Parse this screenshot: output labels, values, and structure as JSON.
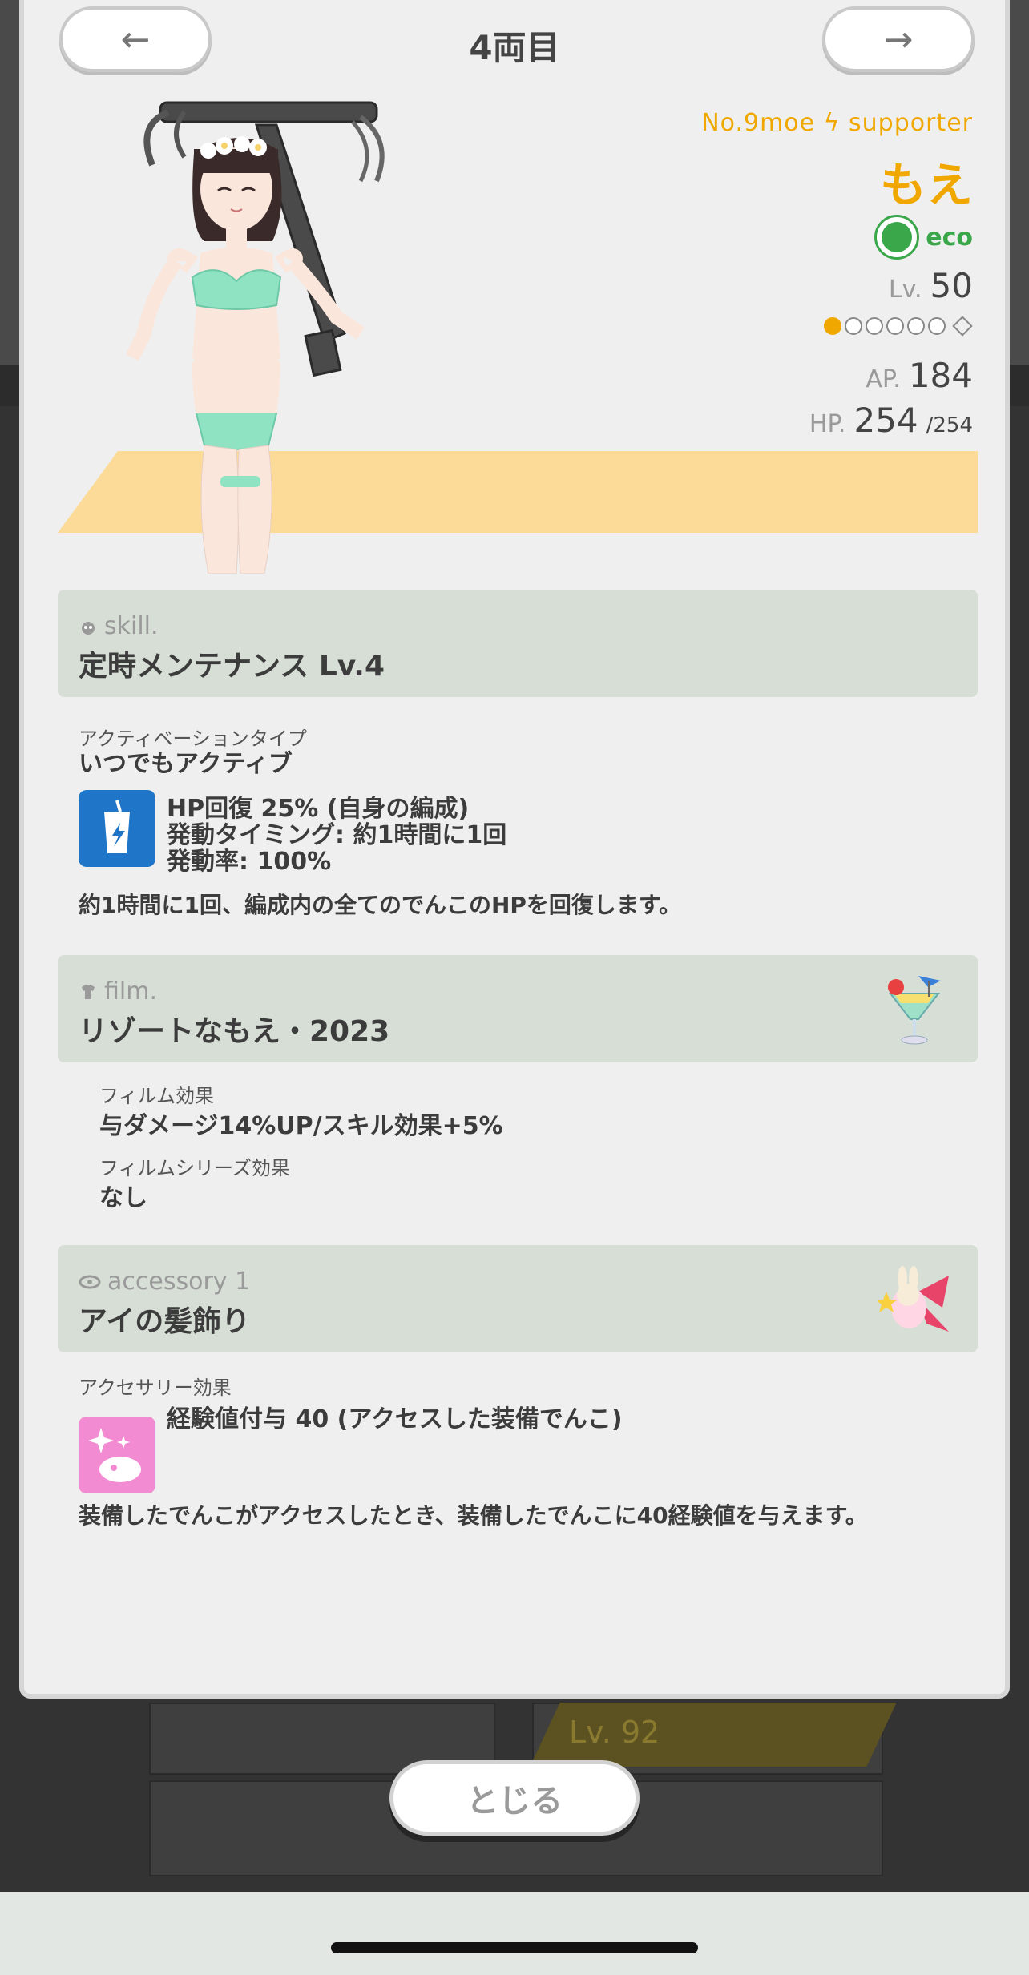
{
  "header": {
    "title": "4両目",
    "prev_label": "←",
    "next_label": "→"
  },
  "character": {
    "unit_no": "No.9moe",
    "role": "supporter",
    "bolt_glyph": "ϟ",
    "name": "もえ",
    "attribute": "eco",
    "level_label": "Lv.",
    "level": "50",
    "rank_filled": 1,
    "rank_total": 6,
    "ap_label": "AP.",
    "ap": "184",
    "hp_label": "HP.",
    "hp": "254",
    "hp_max": "/254"
  },
  "skill": {
    "section_label": "skill.",
    "name": "定時メンテナンス Lv.4",
    "activation_type_label": "アクティベーションタイプ",
    "activation_type": "いつでもアクティブ",
    "effect_line1": "HP回復 25% (自身の編成)",
    "effect_line2": "発動タイミング: 約1時間に1回",
    "effect_line3": "発動率: 100%",
    "description": "約1時間に1回、編成内の全てのでんこのHPを回復します。"
  },
  "film": {
    "section_label": "film.",
    "name": "リゾートなもえ・2023",
    "effect_label": "フィルム効果",
    "effect": "与ダメージ14%UP/スキル効果+5%",
    "series_label": "フィルムシリーズ効果",
    "series_effect": "なし"
  },
  "accessory": {
    "section_label": "accessory 1",
    "name": "アイの髪飾り",
    "effect_label": "アクセサリー効果",
    "effect": "経験値付与 40 (アクセスした装備でんこ)",
    "description": "装備したでんこがアクセスしたとき、装備したでんこに40経験値を与えます。"
  },
  "background": {
    "level_text": "Lv. 92"
  },
  "footer": {
    "close_label": "とじる"
  },
  "colors": {
    "accent_orange": "#f0a800",
    "eco_green": "#3aa84a",
    "section_bg": "#d6ded6",
    "skill_icon_bg": "#1f76c9",
    "accessory_icon_bg": "#f38bd3",
    "yellow_band": "#fcdb98"
  }
}
